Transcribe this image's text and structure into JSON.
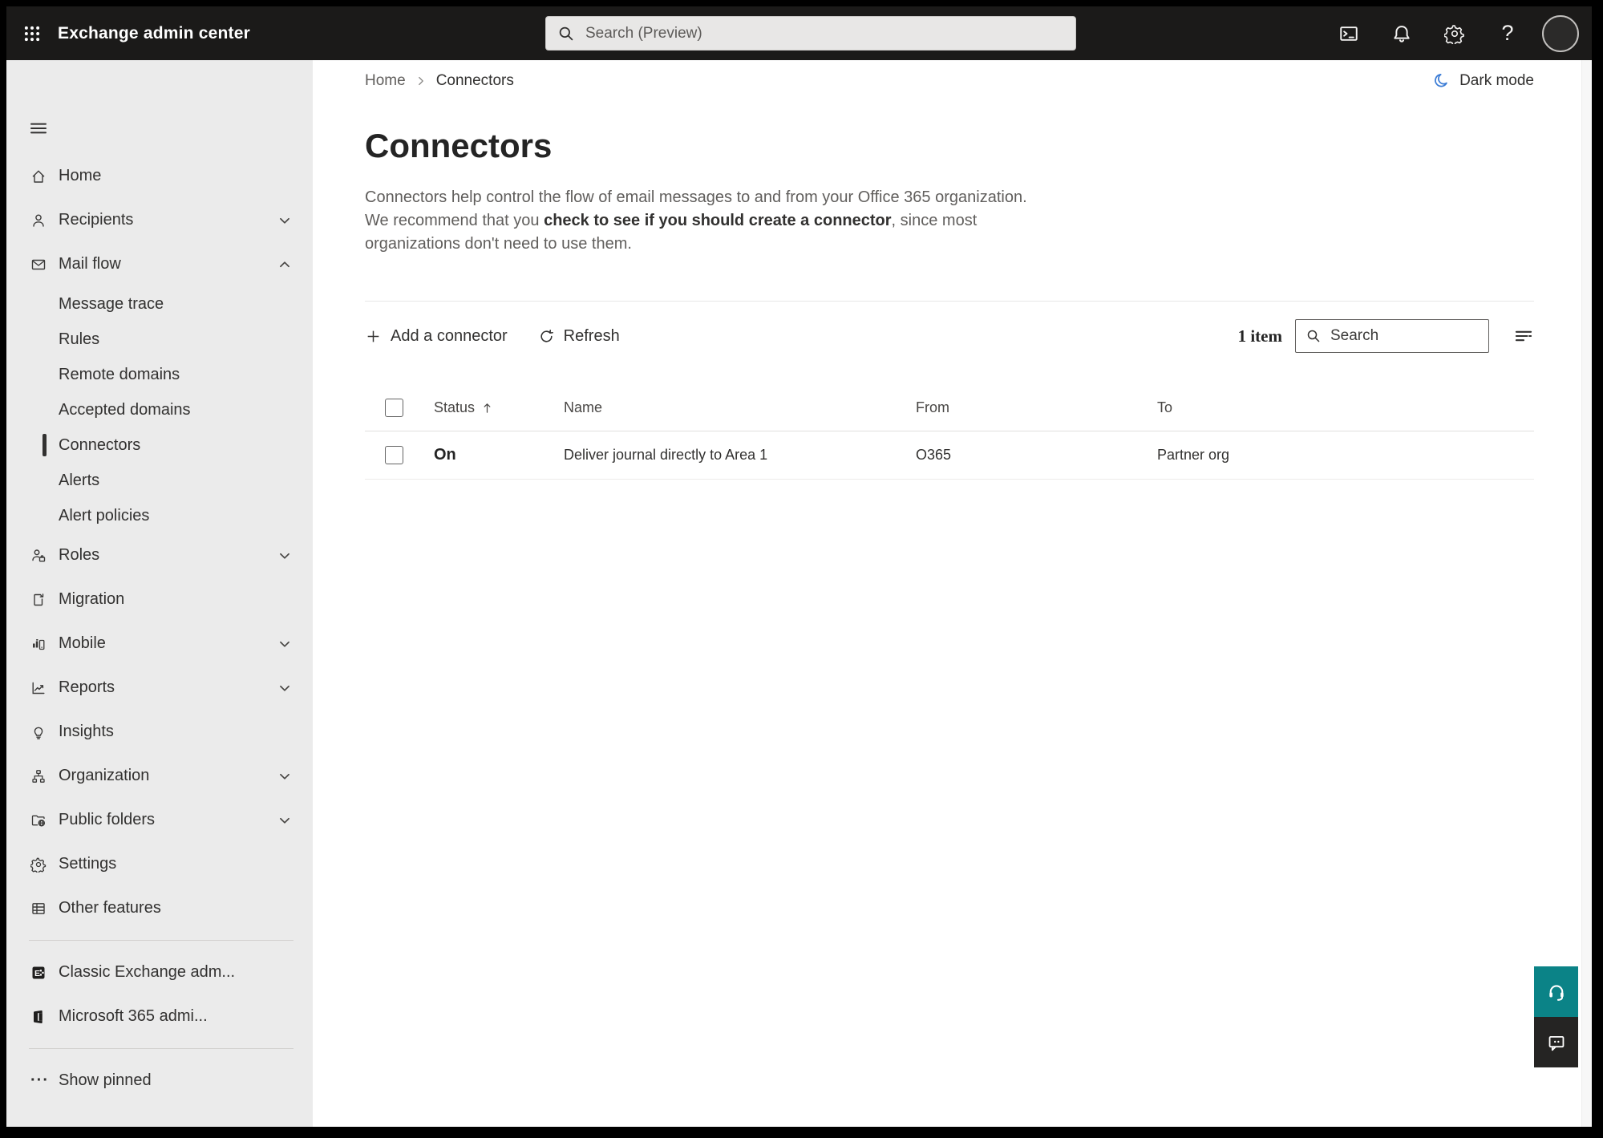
{
  "topbar": {
    "title": "Exchange admin center",
    "search_placeholder": "Search (Preview)",
    "help_glyph": "?"
  },
  "sidebar": {
    "items": [
      {
        "label": "Home"
      },
      {
        "label": "Recipients"
      },
      {
        "label": "Mail flow"
      },
      {
        "label": "Roles"
      },
      {
        "label": "Migration"
      },
      {
        "label": "Mobile"
      },
      {
        "label": "Reports"
      },
      {
        "label": "Insights"
      },
      {
        "label": "Organization"
      },
      {
        "label": "Public folders"
      },
      {
        "label": "Settings"
      },
      {
        "label": "Other features"
      }
    ],
    "mail_flow_children": [
      {
        "label": "Message trace"
      },
      {
        "label": "Rules"
      },
      {
        "label": "Remote domains"
      },
      {
        "label": "Accepted domains"
      },
      {
        "label": "Connectors",
        "selected": true
      },
      {
        "label": "Alerts"
      },
      {
        "label": "Alert policies"
      }
    ],
    "footer_items": [
      {
        "label": "Classic Exchange adm..."
      },
      {
        "label": "Microsoft 365 admi..."
      }
    ],
    "show_pinned_label": "Show pinned",
    "show_pinned_glyph": "···"
  },
  "main": {
    "breadcrumb": {
      "home": "Home",
      "current": "Connectors"
    },
    "dark_mode_label": "Dark mode",
    "title": "Connectors",
    "description": {
      "before": "Connectors help control the flow of email messages to and from your Office 365 organization. We recommend that you ",
      "link": "check to see if you should create a connector",
      "after": ", since most organizations don't need to use them."
    },
    "toolbar": {
      "add_label": "Add a connector",
      "refresh_label": "Refresh",
      "item_count": "1 item",
      "search_placeholder": "Search"
    },
    "table": {
      "headers": [
        "Status",
        "Name",
        "From",
        "To"
      ],
      "rows": [
        {
          "status": "On",
          "name": "Deliver journal directly to Area 1",
          "from": "O365",
          "to": "Partner org"
        }
      ]
    }
  },
  "colors": {
    "top_bar": "#1b1a19",
    "sidebar_bg": "#ebebeb",
    "accent_blue": "#3a7bd5",
    "help_teal": "#0b8387",
    "feedback_dark": "#252423",
    "selected_indicator": "#323130"
  }
}
